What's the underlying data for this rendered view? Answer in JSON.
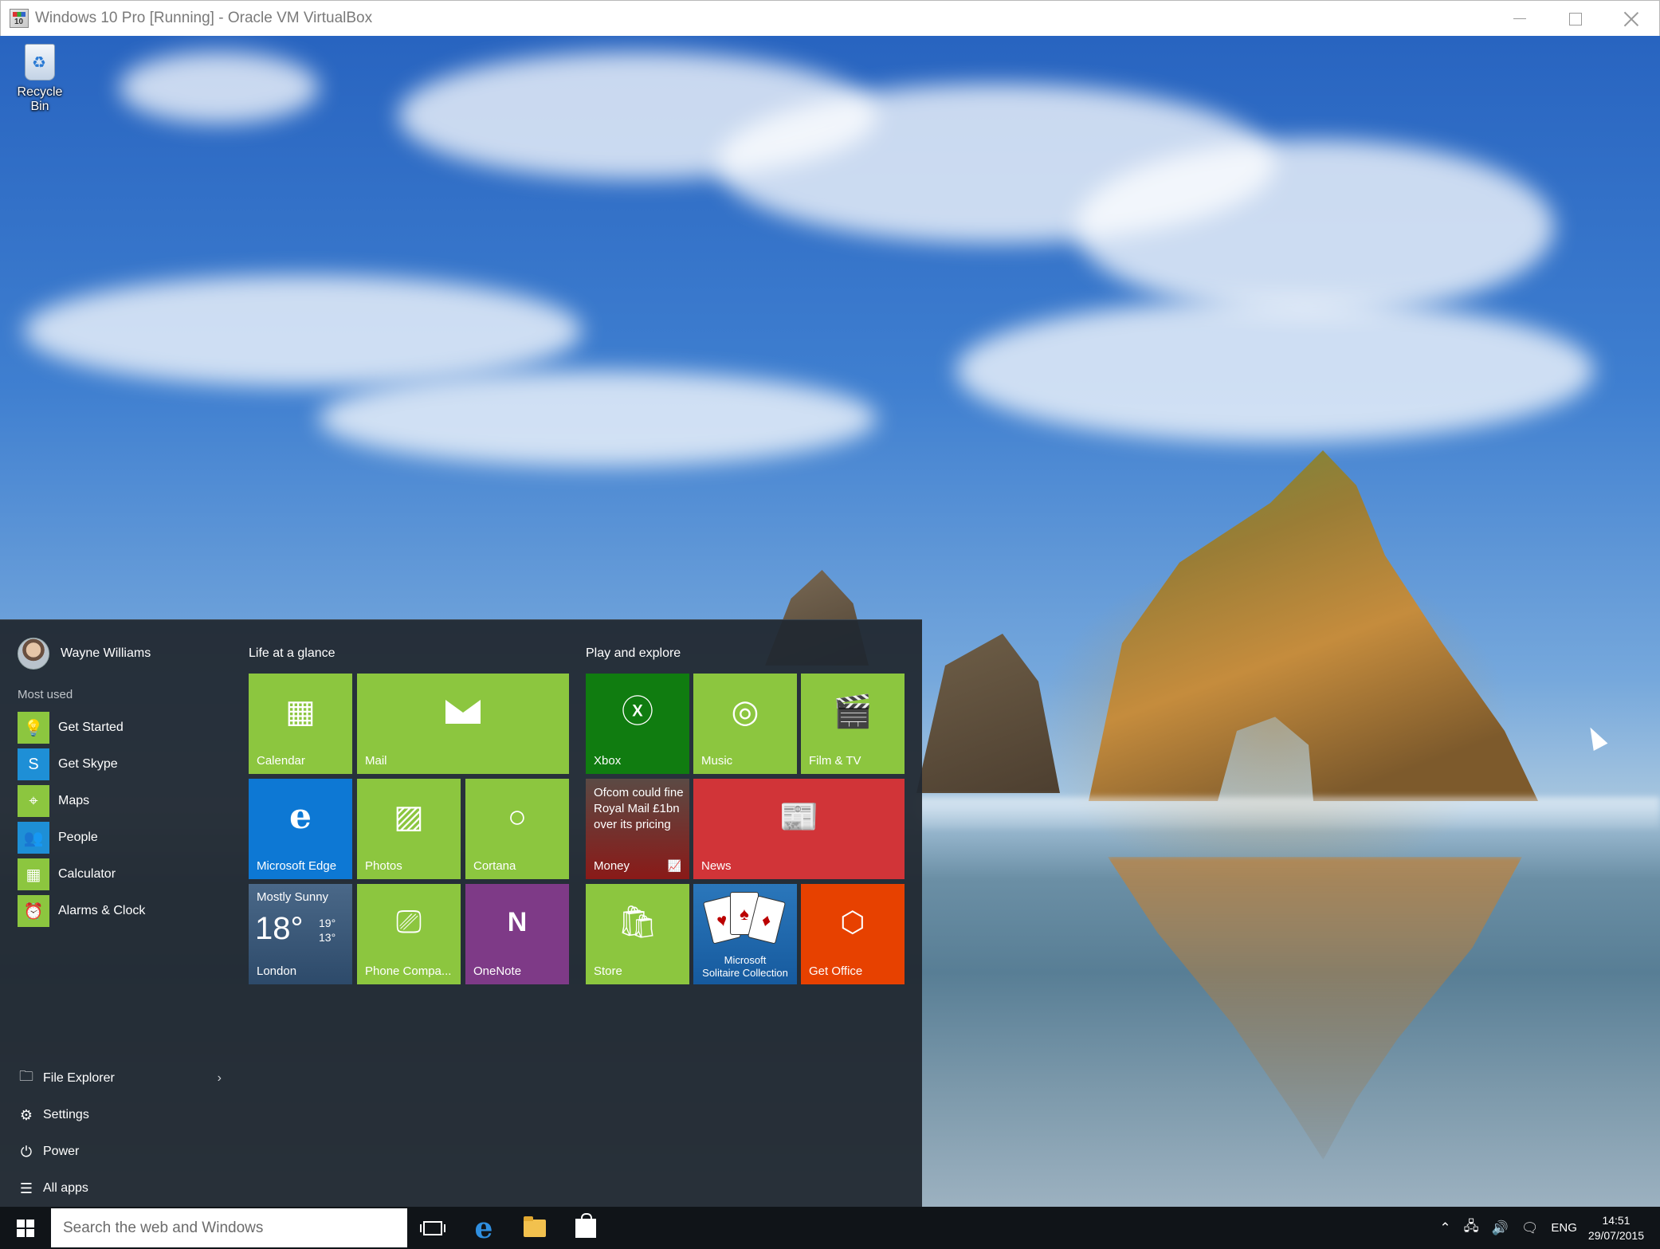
{
  "window": {
    "title": "Windows 10 Pro [Running] - Oracle VM VirtualBox",
    "app_icon_text": "10"
  },
  "desktop": {
    "icons": [
      {
        "label": "Recycle Bin",
        "icon": "recycle-bin-icon"
      }
    ]
  },
  "start_menu": {
    "user": {
      "name": "Wayne Williams"
    },
    "most_used_label": "Most used",
    "most_used": [
      {
        "label": "Get Started",
        "icon": "lightbulb-icon",
        "glyph": "💡"
      },
      {
        "label": "Get Skype",
        "icon": "skype-icon",
        "glyph": "S"
      },
      {
        "label": "Maps",
        "icon": "maps-icon",
        "glyph": "⌖"
      },
      {
        "label": "People",
        "icon": "people-icon",
        "glyph": "👥"
      },
      {
        "label": "Calculator",
        "icon": "calculator-icon",
        "glyph": "▦"
      },
      {
        "label": "Alarms & Clock",
        "icon": "alarm-clock-icon",
        "glyph": "⏰"
      }
    ],
    "bottom": [
      {
        "label": "File Explorer",
        "icon": "file-explorer-icon",
        "glyph": "🗀",
        "chevron": "›"
      },
      {
        "label": "Settings",
        "icon": "settings-gear-icon",
        "glyph": "⚙"
      },
      {
        "label": "Power",
        "icon": "power-icon",
        "glyph": "⏻"
      },
      {
        "label": "All apps",
        "icon": "all-apps-icon",
        "glyph": "☰"
      }
    ],
    "groups": {
      "life": "Life at a glance",
      "play": "Play and explore"
    },
    "tiles": {
      "calendar": "Calendar",
      "mail": "Mail",
      "edge": "Microsoft Edge",
      "photos": "Photos",
      "cortana": "Cortana",
      "weather_condition": "Mostly Sunny",
      "weather_temp": "18°",
      "weather_high": "19°",
      "weather_low": "13°",
      "weather_city": "London",
      "phone": "Phone Compa...",
      "onenote": "OneNote",
      "xbox": "Xbox",
      "music": "Music",
      "film": "Film & TV",
      "money_headline": "Ofcom could fine Royal Mail £1bn over its pricing",
      "money": "Money",
      "news": "News",
      "store": "Store",
      "solitaire_line1": "Microsoft",
      "solitaire_line2": "Solitaire Collection",
      "office": "Get Office"
    }
  },
  "taskbar": {
    "search_placeholder": "Search the web and Windows",
    "language": "ENG",
    "time": "14:51",
    "date": "29/07/2015"
  }
}
